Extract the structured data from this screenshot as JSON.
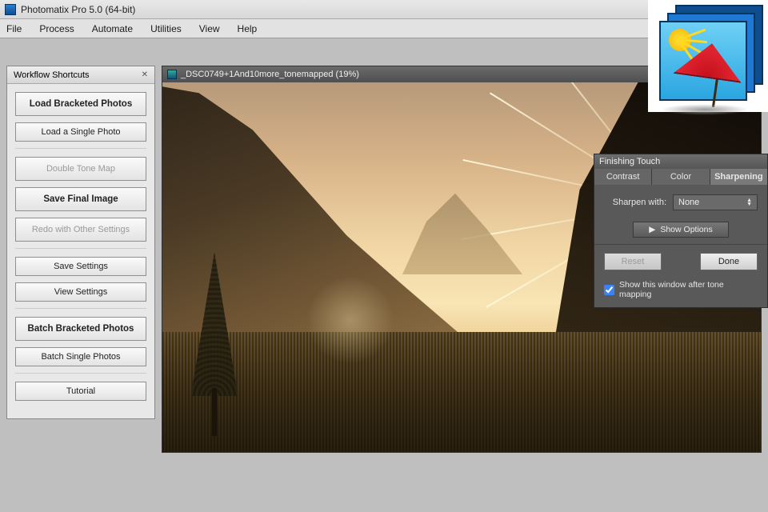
{
  "app": {
    "title": "Photomatix Pro 5.0 (64-bit)"
  },
  "menubar": [
    "File",
    "Process",
    "Automate",
    "Utilities",
    "View",
    "Help"
  ],
  "shortcuts": {
    "title": "Workflow Shortcuts",
    "load_bracketed": "Load Bracketed Photos",
    "load_single": "Load a Single Photo",
    "double_tone": "Double Tone Map",
    "save_final": "Save Final Image",
    "redo": "Redo with Other Settings",
    "save_settings": "Save Settings",
    "view_settings": "View Settings",
    "batch_bracketed": "Batch Bracketed Photos",
    "batch_single": "Batch Single Photos",
    "tutorial": "Tutorial"
  },
  "document": {
    "title": "_DSC0749+1And10more_tonemapped (19%)"
  },
  "finishing": {
    "title": "Finishing Touch",
    "tabs": {
      "contrast": "Contrast",
      "color": "Color",
      "sharpening": "Sharpening"
    },
    "active_tab": "sharpening",
    "sharpen_label": "Sharpen with:",
    "sharpen_value": "None",
    "show_options": "Show Options",
    "reset": "Reset",
    "done": "Done",
    "checkbox_label": "Show this window after tone mapping",
    "checkbox_checked": true
  }
}
